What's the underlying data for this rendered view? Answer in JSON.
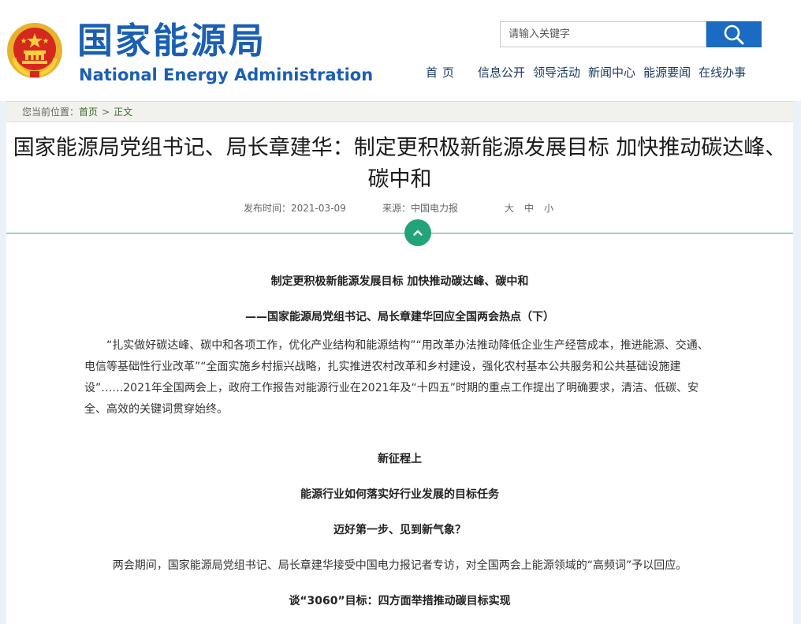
{
  "header": {
    "site_title_cn": "国家能源局",
    "site_title_en": "National Energy Administration",
    "search_placeholder": "请输入关键字",
    "nav": [
      "首页",
      "信息公开",
      "领导活动",
      "新闻中心",
      "能源要闻",
      "在线办事"
    ]
  },
  "breadcrumb": {
    "prefix": "您当前位置：",
    "items": [
      "首页",
      "正文"
    ]
  },
  "article": {
    "title": "国家能源局党组书记、局长章建华：制定更积极新能源发展目标 加快推动碳达峰、碳中和",
    "publish_label": "发布时间：",
    "publish_date": "2021-03-09",
    "source_label": "来源：",
    "source": "中国电力报",
    "font_sizes": [
      "大",
      "中",
      "小"
    ],
    "heading1": "制定更积极新能源发展目标  加快推动碳达峰、碳中和",
    "heading2": "——国家能源局党组书记、局长章建华回应全国两会热点（下）",
    "para1": "“扎实做好碳达峰、碳中和各项工作，优化产业结构和能源结构”“用改革办法推动降低企业生产经营成本，推进能源、交通、电信等基础性行业改革”“全面实施乡村振兴战略，扎实推进农村改革和乡村建设，强化农村基本公共服务和公共基础设施建设”……2021年全国两会上，政府工作报告对能源行业在2021年及“十四五”时期的重点工作提出了明确要求，清洁、低碳、安全、高效的关键词贯穿始终。",
    "heading3": "新征程上",
    "heading4": "能源行业如何落实好行业发展的目标任务",
    "heading5": "迈好第一步、见到新气象？",
    "para2": "两会期间，国家能源局党组书记、局长章建华接受中国电力报记者专访，对全国两会上能源领域的“高频词”予以回应。",
    "heading6": "谈“3060”目标：四方面举措推动碳目标实现"
  },
  "colors": {
    "brand_blue": "#1a5fb4",
    "search_button": "#1a6bc1",
    "accent_green": "#22a37a",
    "breadcrumb_link": "#3a6e2a"
  },
  "icons": {
    "emblem": "national-emblem-icon",
    "search": "search-icon",
    "toggle": "chevron-up-icon"
  }
}
